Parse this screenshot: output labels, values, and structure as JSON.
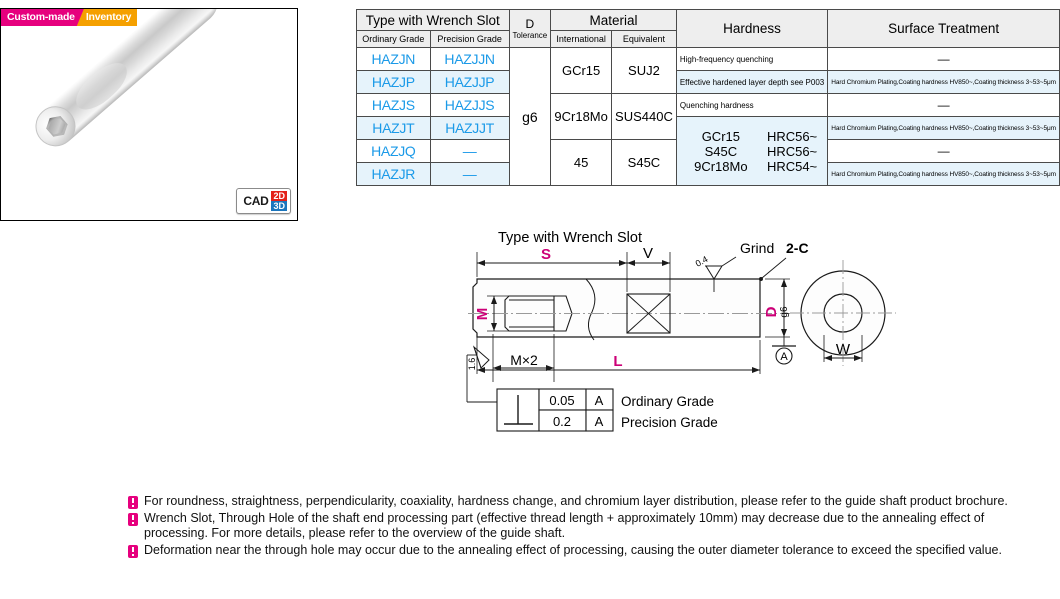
{
  "badges": {
    "custom_made": "Custom-made",
    "inventory": "Inventory"
  },
  "cad": {
    "label": "CAD",
    "two_d": "2D",
    "three_d": "3D"
  },
  "colors": {
    "custom_made_bg": "#e6007e",
    "inventory_bg": "#f5a000",
    "code_blue": "#1b9ae8",
    "row_alt": "#e6f3fb",
    "dim_magenta": "#cc0077",
    "cad_2d": "#e32119",
    "cad_3d": "#1b75bc"
  },
  "table": {
    "headers": {
      "type_group": "Type with Wrench Slot",
      "ordinary_grade": "Ordinary Grade",
      "precision_grade": "Precision Grade",
      "d_tolerance_line1": "D",
      "d_tolerance_line2": "Tolerance",
      "material_group": "Material",
      "international": "International",
      "equivalent": "Equivalent",
      "hardness": "Hardness",
      "surface_treatment": "Surface Treatment"
    },
    "rows": [
      {
        "ordinary": "HAZJN",
        "precision": "HAZJJN"
      },
      {
        "ordinary": "HAZJP",
        "precision": "HAZJJP"
      },
      {
        "ordinary": "HAZJS",
        "precision": "HAZJJS"
      },
      {
        "ordinary": "HAZJT",
        "precision": "HAZJJT"
      },
      {
        "ordinary": "HAZJQ",
        "precision": "—"
      },
      {
        "ordinary": "HAZJR",
        "precision": "—"
      }
    ],
    "d_tolerance": "g6",
    "materials": [
      {
        "international": "GCr15",
        "equivalent": "SUJ2"
      },
      {
        "international": "9Cr18Mo",
        "equivalent": "SUS440C"
      },
      {
        "international": "45",
        "equivalent": "S45C"
      }
    ],
    "hardness": {
      "line1": "High-frequency quenching",
      "line2": "Effective hardened layer depth see P003",
      "line3": "Quenching hardness",
      "values": [
        {
          "material": "GCr15",
          "hrc": "HRC56~"
        },
        {
          "material": "S45C",
          "hrc": "HRC56~"
        },
        {
          "material": "9Cr18Mo",
          "hrc": "HRC54~"
        }
      ]
    },
    "surface_treatment": {
      "none": "—",
      "plating": "Hard Chromium Plating,Coating hardness HV850~,Coating thickness 3~53~5μm"
    }
  },
  "drawing": {
    "title": "Type with Wrench Slot",
    "dim_s": "S",
    "dim_v": "V",
    "dim_l": "L",
    "dim_m": "M",
    "dim_w": "W",
    "dim_d": "D",
    "dim_d_tol": "g6",
    "thread": "M×2",
    "grind": "Grind",
    "grind_value": "0.4",
    "rough_value": "1.6",
    "chamfer": "2-C",
    "datum": "A",
    "tolerance_box": {
      "symbol": "perpendicularity-symbol",
      "rows": [
        {
          "value": "0.05",
          "datum": "A",
          "label": "Ordinary Grade"
        },
        {
          "value": "0.2",
          "datum": "A",
          "label": "Precision Grade"
        }
      ]
    }
  },
  "notes": [
    "For roundness, straightness, perpendicularity, coaxiality, hardness change, and chromium layer distribution, please refer to the guide shaft product brochure.",
    "Wrench Slot, Through Hole of the shaft end processing part (effective thread length + approximately 10mm) may decrease due to the annealing effect of processing. For more details, please refer to the overview of the guide shaft.",
    "Deformation near the through hole may occur due to the annealing effect of processing, causing the outer diameter tolerance to exceed the specified value."
  ]
}
